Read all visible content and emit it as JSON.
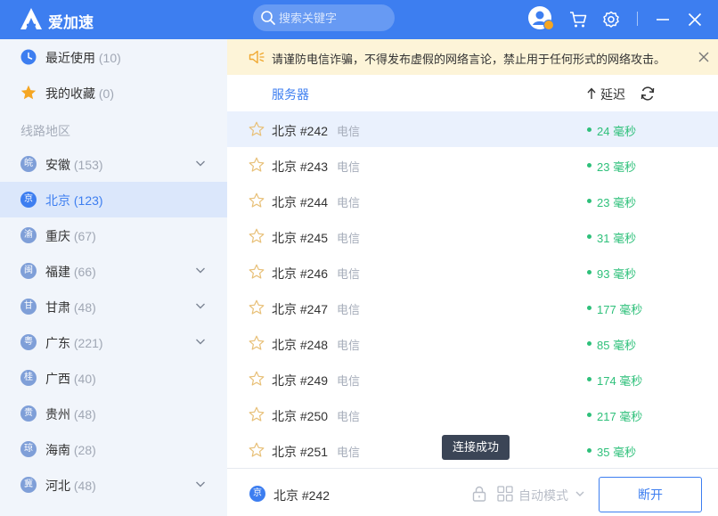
{
  "app": {
    "title": "爱加速"
  },
  "search": {
    "placeholder": "搜索关键字"
  },
  "notice": {
    "text": "请谨防电信诈骗，不得发布虚假的网络言论，禁止用于任何形式的网络攻击。"
  },
  "sidebar": {
    "quick": [
      {
        "label": "最近使用",
        "count": "(10)"
      },
      {
        "label": "我的收藏",
        "count": "(0)"
      }
    ],
    "section_title": "线路地区",
    "regions": [
      {
        "badge": "皖",
        "label": "安徽",
        "count": "(153)",
        "expandable": true,
        "active": false
      },
      {
        "badge": "京",
        "label": "北京",
        "count": "(123)",
        "expandable": false,
        "active": true
      },
      {
        "badge": "渝",
        "label": "重庆",
        "count": "(67)",
        "expandable": false,
        "active": false
      },
      {
        "badge": "闽",
        "label": "福建",
        "count": "(66)",
        "expandable": true,
        "active": false
      },
      {
        "badge": "甘",
        "label": "甘肃",
        "count": "(48)",
        "expandable": true,
        "active": false
      },
      {
        "badge": "粤",
        "label": "广东",
        "count": "(221)",
        "expandable": true,
        "active": false
      },
      {
        "badge": "桂",
        "label": "广西",
        "count": "(40)",
        "expandable": false,
        "active": false
      },
      {
        "badge": "贵",
        "label": "贵州",
        "count": "(48)",
        "expandable": false,
        "active": false
      },
      {
        "badge": "琼",
        "label": "海南",
        "count": "(28)",
        "expandable": false,
        "active": false
      },
      {
        "badge": "冀",
        "label": "河北",
        "count": "(48)",
        "expandable": true,
        "active": false
      }
    ]
  },
  "list": {
    "col_server": "服务器",
    "col_latency": "延迟",
    "servers": [
      {
        "name": "北京 #242",
        "isp": "电信",
        "latency": "24 毫秒",
        "selected": true
      },
      {
        "name": "北京 #243",
        "isp": "电信",
        "latency": "23 毫秒",
        "selected": false
      },
      {
        "name": "北京 #244",
        "isp": "电信",
        "latency": "23 毫秒",
        "selected": false
      },
      {
        "name": "北京 #245",
        "isp": "电信",
        "latency": "31 毫秒",
        "selected": false
      },
      {
        "name": "北京 #246",
        "isp": "电信",
        "latency": "93 毫秒",
        "selected": false
      },
      {
        "name": "北京 #247",
        "isp": "电信",
        "latency": "177 毫秒",
        "selected": false
      },
      {
        "name": "北京 #248",
        "isp": "电信",
        "latency": "85 毫秒",
        "selected": false
      },
      {
        "name": "北京 #249",
        "isp": "电信",
        "latency": "174 毫秒",
        "selected": false
      },
      {
        "name": "北京 #250",
        "isp": "电信",
        "latency": "217 毫秒",
        "selected": false
      },
      {
        "name": "北京 #251",
        "isp": "电信",
        "latency": "35 毫秒",
        "selected": false
      }
    ]
  },
  "toast": {
    "text": "连接成功"
  },
  "footer": {
    "badge": "京",
    "current_server": "北京 #242",
    "mode_label": "自动模式",
    "disconnect_label": "断开"
  },
  "colors": {
    "brand": "#3d7ef0",
    "latency_good": "#2ec07a",
    "notice_bg": "#fdf4d8"
  }
}
